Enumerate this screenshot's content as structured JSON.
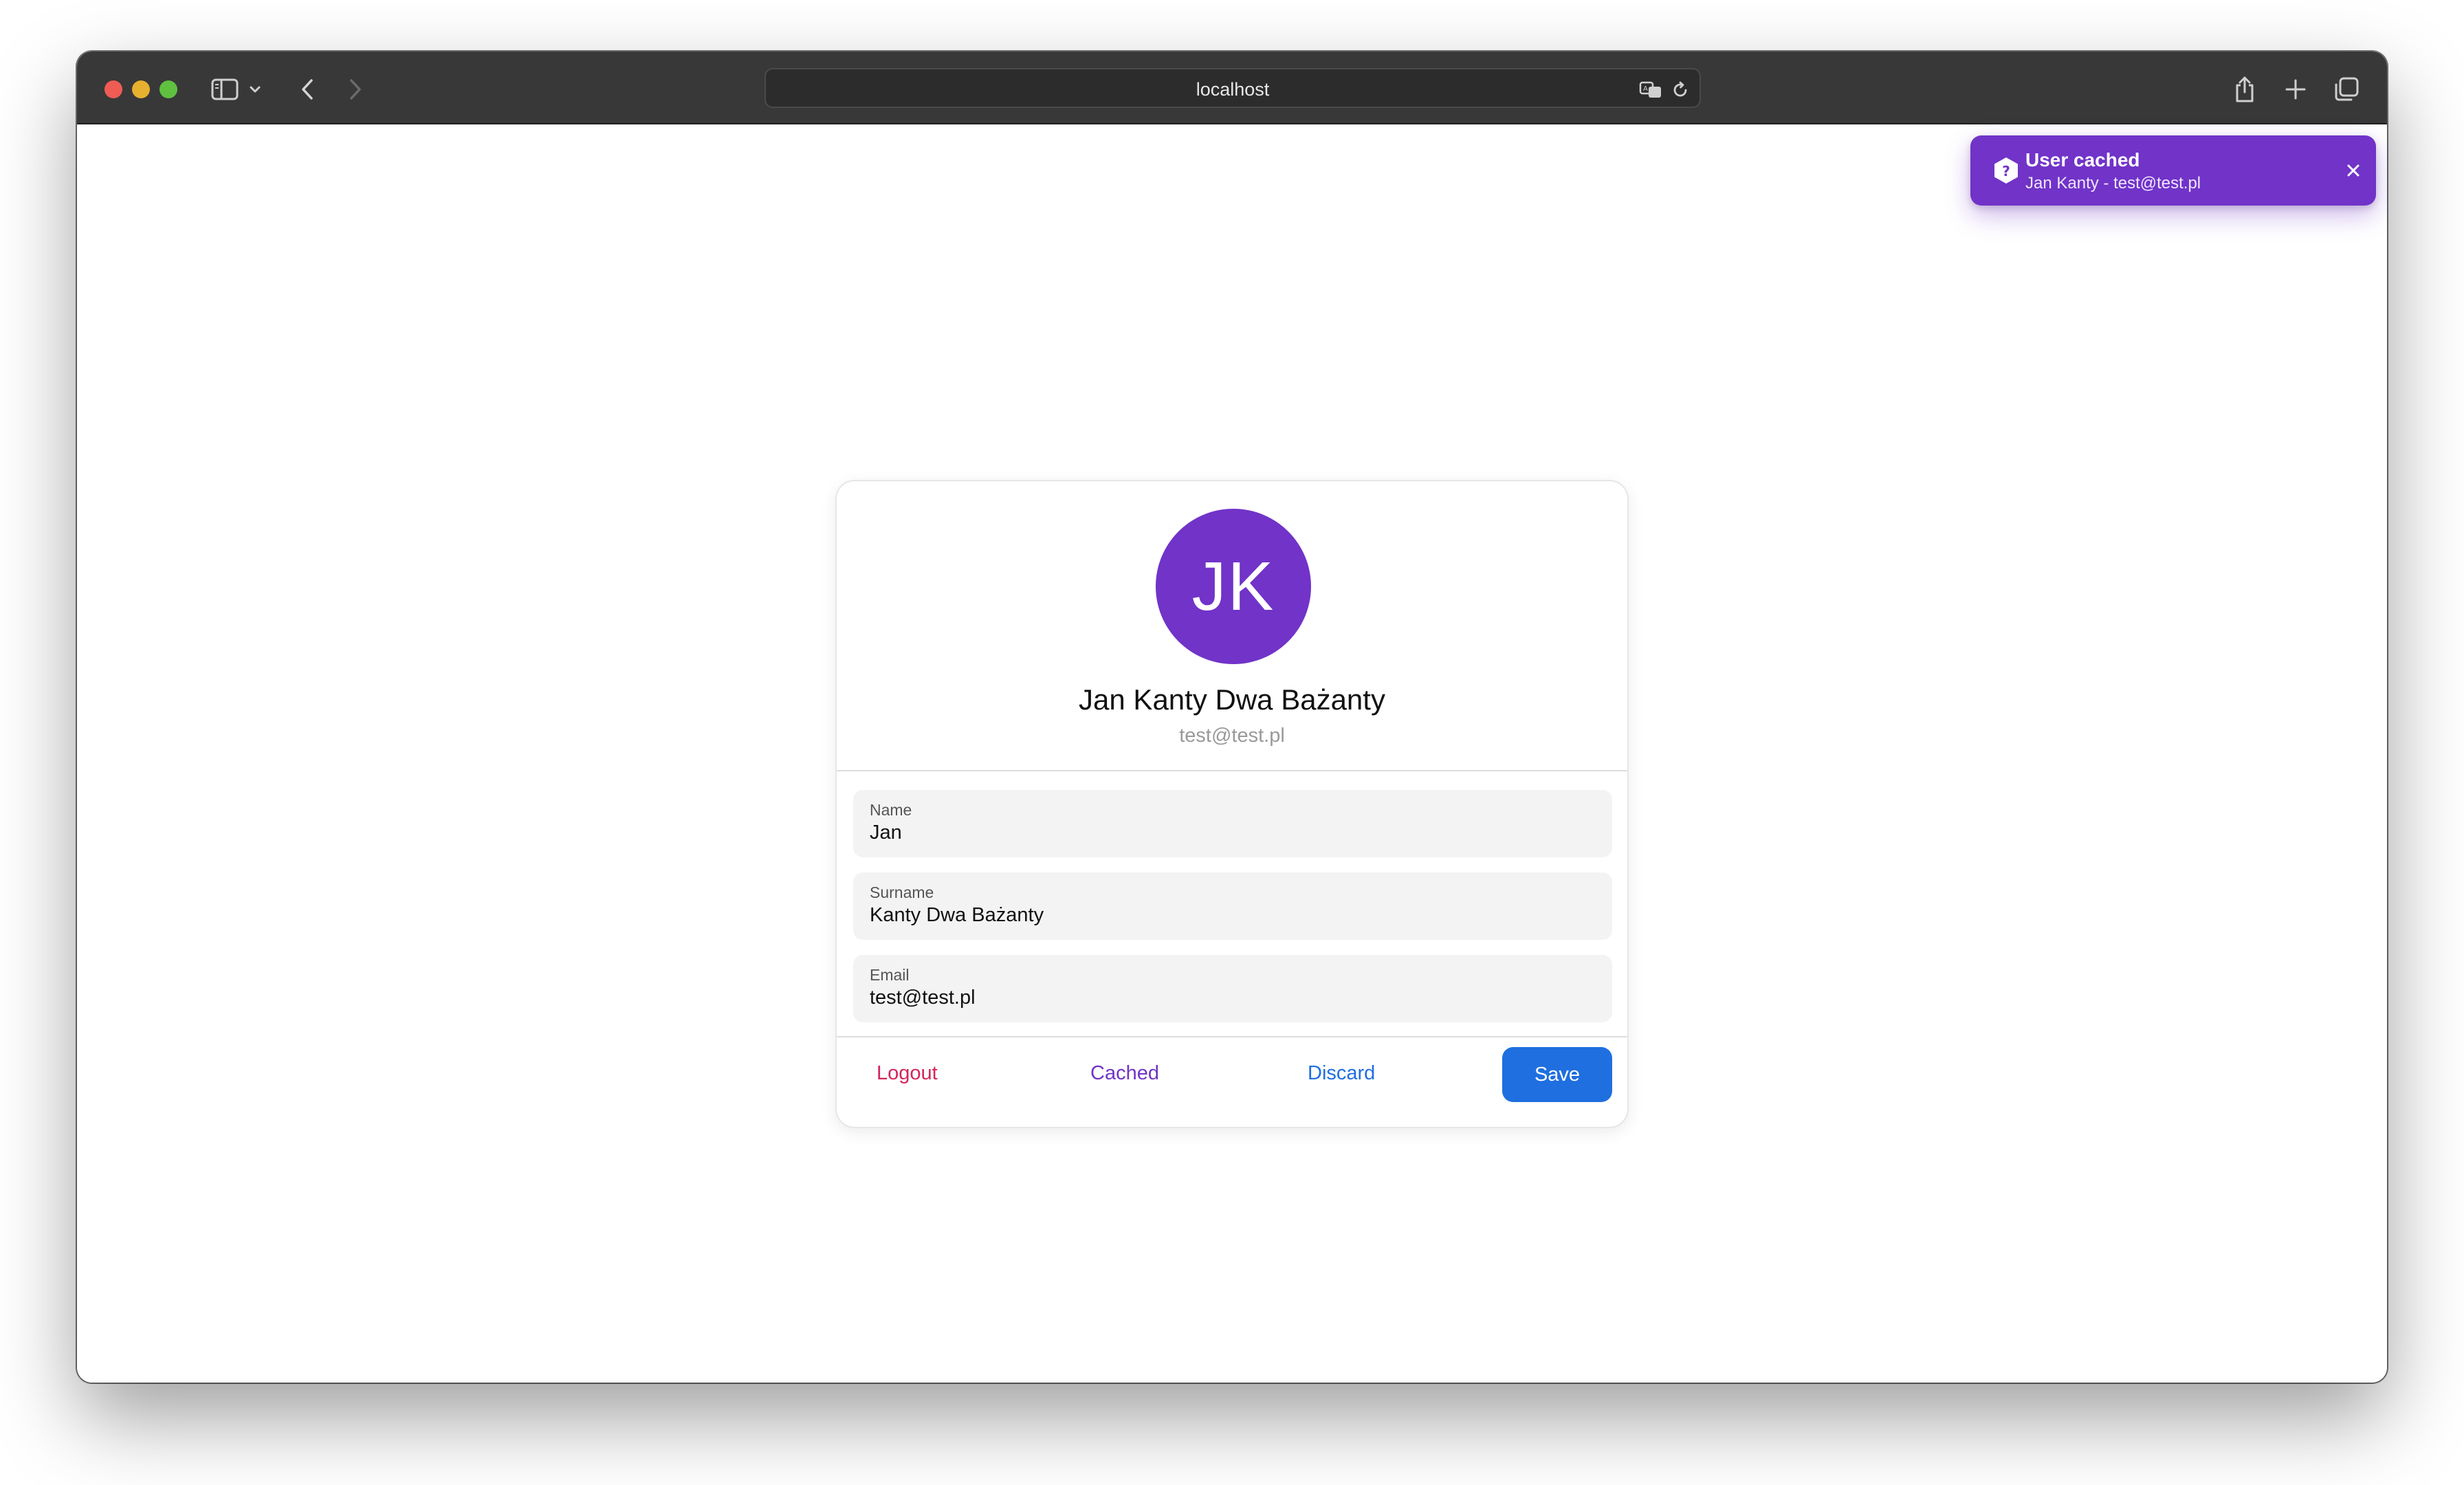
{
  "browser": {
    "address": "localhost"
  },
  "toast": {
    "title": "User cached",
    "message": "Jan Kanty - test@test.pl",
    "color": "#7133c8"
  },
  "profile": {
    "initials": "JK",
    "full_name": "Jan Kanty Dwa Bażanty",
    "email": "test@test.pl",
    "avatar_color": "#7133c8"
  },
  "form": {
    "fields": [
      {
        "label": "Name",
        "value": "Jan"
      },
      {
        "label": "Surname",
        "value": "Kanty Dwa Bażanty"
      },
      {
        "label": "Email",
        "value": "test@test.pl"
      }
    ]
  },
  "actions": {
    "logout": "Logout",
    "cached": "Cached",
    "discard": "Discard",
    "save": "Save",
    "colors": {
      "logout": "#d6245a",
      "cached": "#7133c8",
      "discard": "#1f6fe0",
      "save": "#1f6fe0"
    }
  }
}
